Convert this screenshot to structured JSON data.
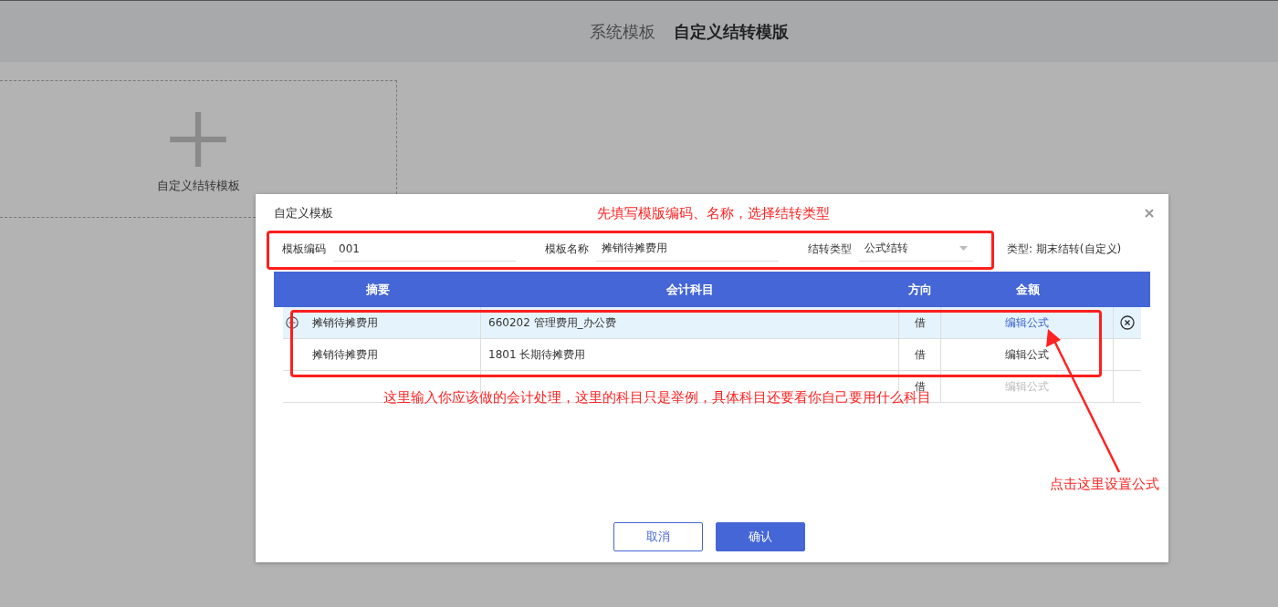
{
  "top_tabs": [
    {
      "label": "系统模板",
      "selected": false
    },
    {
      "label": "自定义结转模版",
      "selected": true
    }
  ],
  "add_card": {
    "label": "自定义结转模板"
  },
  "dialog": {
    "title": "自定义模板",
    "fields": [
      {
        "kind": "text",
        "label": "模板编码",
        "value": "001"
      },
      {
        "kind": "text",
        "label": "模板名称",
        "value": "摊销待摊费用"
      },
      {
        "kind": "select",
        "label": "结转类型",
        "value": "公式结转"
      }
    ],
    "type_note": "类型: 期末结转(自定义)",
    "columns": [
      "摘要",
      "会计科目",
      "方向",
      "金额"
    ],
    "rows": [
      {
        "summary": "摊销待摊费用",
        "subject": "660202 管理费用_办公费",
        "direction": "借",
        "amount": "编辑公式",
        "selected": true,
        "disabled": false
      },
      {
        "summary": "摊销待摊费用",
        "subject": "1801 长期待摊费用",
        "direction": "借",
        "amount": "编辑公式",
        "selected": false,
        "disabled": false
      },
      {
        "direction": "借",
        "amount": "编辑公式",
        "selected": false,
        "disabled": true
      }
    ],
    "buttons": [
      {
        "label": "取消",
        "kind": "secondary"
      },
      {
        "label": "确认",
        "kind": "primary"
      }
    ]
  },
  "annotations": [
    "先填写模版编码、名称，选择结转类型",
    "这里输入你应该做的会计处理，这里的科目只是举例，具体科目还要看你自己要用什么科目",
    "点击这里设置公式"
  ]
}
